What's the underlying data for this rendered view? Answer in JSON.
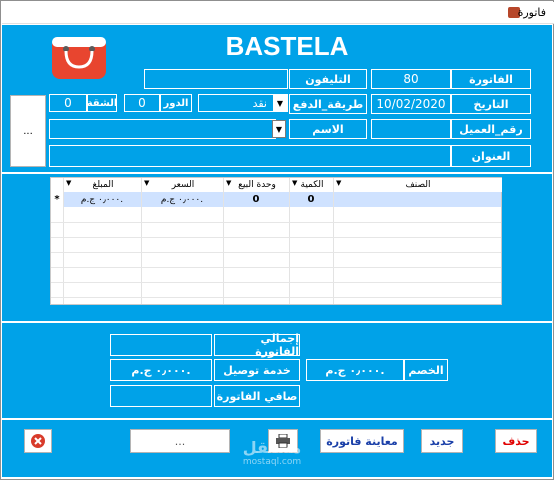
{
  "window": {
    "title": "فاتورة"
  },
  "header": {
    "brand": "BASTELA"
  },
  "fields": {
    "invoice_label": "الفاتورة",
    "invoice_value": "80",
    "phone_label": "التليفون",
    "phone_value": "",
    "date_label": "التاريخ",
    "date_value": "10/02/2020",
    "payment_label": "طريقة_الدفع",
    "payment_value": "نقد",
    "floor_label": "الدور",
    "floor_value": "0",
    "apartment_label": "الشقة",
    "apartment_value": "0",
    "customer_no_label": "رقم_العميل",
    "customer_no_value": "",
    "name_label": "الاسم",
    "name_value": "",
    "address_label": "العنوان",
    "address_value": "",
    "side_button": "..."
  },
  "grid": {
    "columns": [
      "الصنف",
      "الكمية",
      "وحدة البيع",
      "السعر",
      "المبلغ"
    ],
    "rows": [
      {
        "marker": "*",
        "item": "",
        "qty": "0",
        "unit": "0",
        "price": "٠٫٠٠٠ ج.م.",
        "amount": "٠٫٠٠٠ ج.م."
      }
    ]
  },
  "totals": {
    "total_label": "إجمالي الفاتورة",
    "total_value": "",
    "delivery_label": "خدمة توصيل",
    "delivery_value": "٠٫٠٠٠ ج.م.",
    "discount_label": "الخصم",
    "discount_value": "٠٫٠٠٠ ج.م.",
    "net_label": "صافي الفاتورة",
    "net_value": ""
  },
  "toolbar": {
    "delete_label": "حذف",
    "new_label": "جديد",
    "preview_label": "معاينة فاتورة",
    "search_box_text": "...",
    "close_icon": "close-icon",
    "print_icon": "printer-icon"
  },
  "watermark": {
    "main": "مستقل",
    "sub": "mostaql.com"
  },
  "colors": {
    "form_bg": "#00a2e8",
    "grid_selected": "#cfe2ff",
    "delete_text": "#e00000",
    "button_text_blue": "#1a3fa8"
  }
}
